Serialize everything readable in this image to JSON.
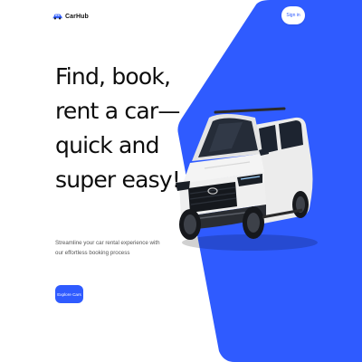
{
  "colors": {
    "accent": "#2f5bff",
    "hero_background": "#2f5bff",
    "text_primary": "#0d0d0d",
    "text_secondary": "#555555",
    "car_body": "#f4f4f4"
  },
  "header": {
    "brand": {
      "icon": "car-icon",
      "name": "CarHub"
    },
    "signin_label": "Sign in"
  },
  "hero": {
    "headline_lines": [
      "Find, book,",
      "rent a car—",
      "quick and",
      "super easy!"
    ],
    "subtitle_lines": [
      "Streamline your car rental experience with",
      "our effortless booking process"
    ],
    "cta_label": "Explore Cars",
    "image": "white-suv"
  }
}
